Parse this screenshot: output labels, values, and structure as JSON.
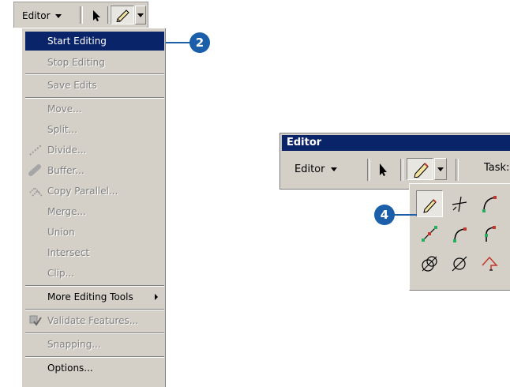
{
  "left_toolbar": {
    "editor_label": "Editor",
    "tools": [
      "arrow-icon",
      "pencil-icon",
      "chevron-down-icon"
    ]
  },
  "menu": {
    "items": [
      {
        "label": "Start Editing",
        "state": "selected"
      },
      {
        "label": "Stop Editing",
        "state": "disabled"
      },
      {
        "label": "Save Edits",
        "state": "disabled"
      },
      {
        "label": "Move...",
        "state": "disabled"
      },
      {
        "label": "Split...",
        "state": "disabled"
      },
      {
        "label": "Divide...",
        "state": "disabled",
        "icon": "divide-icon"
      },
      {
        "label": "Buffer...",
        "state": "disabled",
        "icon": "buffer-icon"
      },
      {
        "label": "Copy Parallel...",
        "state": "disabled",
        "icon": "copy-parallel-icon"
      },
      {
        "label": "Merge...",
        "state": "disabled"
      },
      {
        "label": "Union",
        "state": "disabled"
      },
      {
        "label": "Intersect",
        "state": "disabled"
      },
      {
        "label": "Clip...",
        "state": "disabled"
      },
      {
        "label": "More Editing Tools",
        "state": "enabled",
        "submenu": true
      },
      {
        "label": "Validate Features...",
        "state": "disabled",
        "icon": "validate-icon"
      },
      {
        "label": "Snapping...",
        "state": "disabled"
      },
      {
        "label": "Options...",
        "state": "enabled"
      }
    ]
  },
  "callouts": {
    "step_start": "2",
    "step_palette": "4"
  },
  "editor_window": {
    "title": "Editor",
    "editor_label": "Editor",
    "task_label": "Task:"
  },
  "palette": {
    "tools": [
      "sketch-tool-icon",
      "intersection-tool-icon",
      "arc-tool-icon",
      "midpoint-tool-icon",
      "endpoint-arc-tool-icon",
      "tangent-curve-tool-icon",
      "distance-distance-tool-icon",
      "direction-distance-tool-icon",
      "trace-tool-icon"
    ]
  },
  "colors": {
    "callout": "#1b5faa",
    "menu_highlight": "#0a246a",
    "face": "#d4d0c8"
  }
}
